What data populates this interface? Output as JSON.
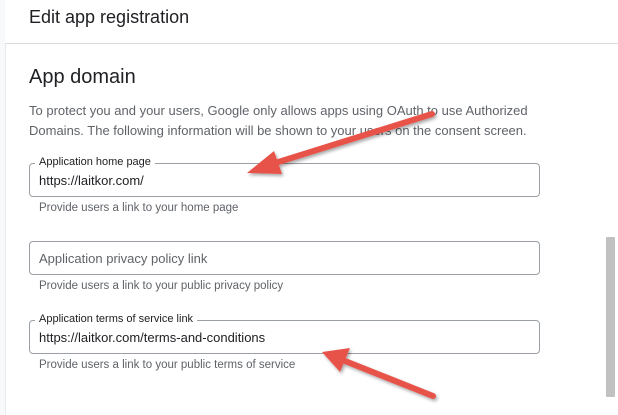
{
  "header": {
    "title": "Edit app registration"
  },
  "section": {
    "title": "App domain",
    "description": "To protect you and your users, Google only allows apps using OAuth to use Authorized Domains. The following information will be shown to your users on the consent screen."
  },
  "fields": {
    "home_page": {
      "label": "Application home page",
      "value": "https://laitkor.com/",
      "helper": "Provide users a link to your home page"
    },
    "privacy_policy": {
      "placeholder": "Application privacy policy link",
      "value": "",
      "helper": "Provide users a link to your public privacy policy"
    },
    "terms_of_service": {
      "label": "Application terms of service link",
      "value": "https://laitkor.com/terms-and-conditions",
      "helper": "Provide users a link to your public terms of service"
    }
  },
  "annotations": {
    "arrow_color": "#e8534a",
    "arrow_icons": [
      "annotation-arrow-icon",
      "annotation-arrow-icon"
    ]
  },
  "colors": {
    "text_primary": "#202124",
    "text_secondary": "#5f6368",
    "field_border": "#9aa0a6",
    "divider": "#dadce0",
    "scrollbar_thumb": "#c1c1c1"
  }
}
